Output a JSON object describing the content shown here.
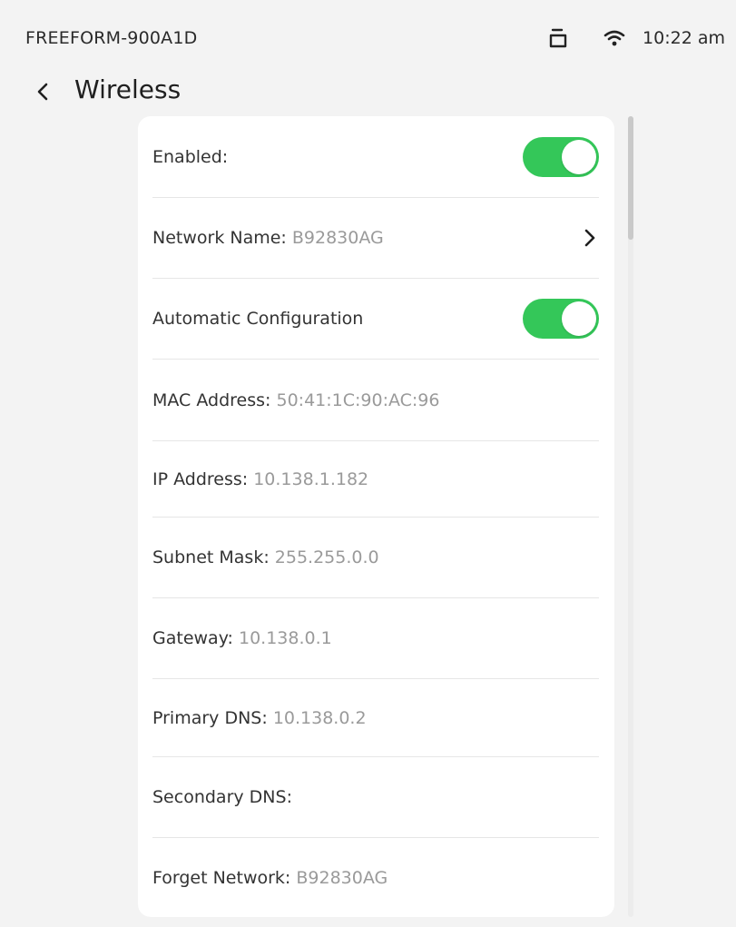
{
  "status_bar": {
    "device_name": "FREEFORM-900A1D",
    "time": "10:22 am",
    "icons": [
      "tray-icon",
      "wifi-icon"
    ]
  },
  "header": {
    "back_icon": "chevron-left-icon",
    "title": "Wireless"
  },
  "settings": {
    "enabled": {
      "label": "Enabled:",
      "on": true
    },
    "network_name": {
      "label": "Network Name:",
      "value": "B92830AG"
    },
    "auto_config": {
      "label": "Automatic Configuration",
      "on": true
    },
    "mac_address": {
      "label": "MAC Address:",
      "value": "50:41:1C:90:AC:96"
    },
    "ip_address": {
      "label": "IP Address:",
      "value": "10.138.1.182"
    },
    "subnet_mask": {
      "label": "Subnet Mask:",
      "value": "255.255.0.0"
    },
    "gateway": {
      "label": "Gateway:",
      "value": "10.138.0.1"
    },
    "primary_dns": {
      "label": "Primary DNS:",
      "value": "10.138.0.2"
    },
    "secondary_dns": {
      "label": "Secondary DNS:",
      "value": ""
    },
    "forget_network": {
      "label": "Forget Network:",
      "value": "B92830AG"
    }
  },
  "colors": {
    "toggle_on": "#34c759",
    "background": "#f3f3f3",
    "card": "#ffffff",
    "value_text": "#9a9a9a"
  }
}
